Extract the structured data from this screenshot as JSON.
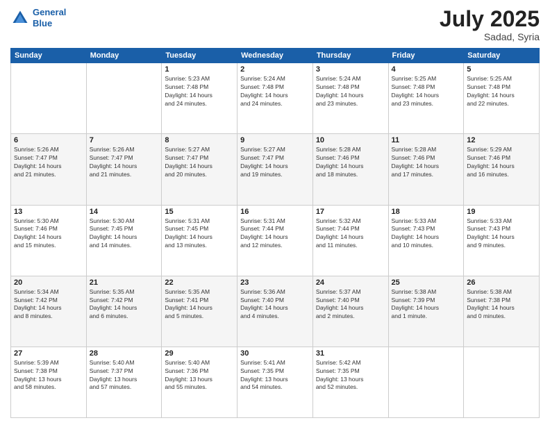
{
  "header": {
    "logo_line1": "General",
    "logo_line2": "Blue",
    "month": "July 2025",
    "location": "Sadad, Syria"
  },
  "weekdays": [
    "Sunday",
    "Monday",
    "Tuesday",
    "Wednesday",
    "Thursday",
    "Friday",
    "Saturday"
  ],
  "weeks": [
    [
      {
        "day": "",
        "info": ""
      },
      {
        "day": "",
        "info": ""
      },
      {
        "day": "1",
        "info": "Sunrise: 5:23 AM\nSunset: 7:48 PM\nDaylight: 14 hours\nand 24 minutes."
      },
      {
        "day": "2",
        "info": "Sunrise: 5:24 AM\nSunset: 7:48 PM\nDaylight: 14 hours\nand 24 minutes."
      },
      {
        "day": "3",
        "info": "Sunrise: 5:24 AM\nSunset: 7:48 PM\nDaylight: 14 hours\nand 23 minutes."
      },
      {
        "day": "4",
        "info": "Sunrise: 5:25 AM\nSunset: 7:48 PM\nDaylight: 14 hours\nand 23 minutes."
      },
      {
        "day": "5",
        "info": "Sunrise: 5:25 AM\nSunset: 7:48 PM\nDaylight: 14 hours\nand 22 minutes."
      }
    ],
    [
      {
        "day": "6",
        "info": "Sunrise: 5:26 AM\nSunset: 7:47 PM\nDaylight: 14 hours\nand 21 minutes."
      },
      {
        "day": "7",
        "info": "Sunrise: 5:26 AM\nSunset: 7:47 PM\nDaylight: 14 hours\nand 21 minutes."
      },
      {
        "day": "8",
        "info": "Sunrise: 5:27 AM\nSunset: 7:47 PM\nDaylight: 14 hours\nand 20 minutes."
      },
      {
        "day": "9",
        "info": "Sunrise: 5:27 AM\nSunset: 7:47 PM\nDaylight: 14 hours\nand 19 minutes."
      },
      {
        "day": "10",
        "info": "Sunrise: 5:28 AM\nSunset: 7:46 PM\nDaylight: 14 hours\nand 18 minutes."
      },
      {
        "day": "11",
        "info": "Sunrise: 5:28 AM\nSunset: 7:46 PM\nDaylight: 14 hours\nand 17 minutes."
      },
      {
        "day": "12",
        "info": "Sunrise: 5:29 AM\nSunset: 7:46 PM\nDaylight: 14 hours\nand 16 minutes."
      }
    ],
    [
      {
        "day": "13",
        "info": "Sunrise: 5:30 AM\nSunset: 7:46 PM\nDaylight: 14 hours\nand 15 minutes."
      },
      {
        "day": "14",
        "info": "Sunrise: 5:30 AM\nSunset: 7:45 PM\nDaylight: 14 hours\nand 14 minutes."
      },
      {
        "day": "15",
        "info": "Sunrise: 5:31 AM\nSunset: 7:45 PM\nDaylight: 14 hours\nand 13 minutes."
      },
      {
        "day": "16",
        "info": "Sunrise: 5:31 AM\nSunset: 7:44 PM\nDaylight: 14 hours\nand 12 minutes."
      },
      {
        "day": "17",
        "info": "Sunrise: 5:32 AM\nSunset: 7:44 PM\nDaylight: 14 hours\nand 11 minutes."
      },
      {
        "day": "18",
        "info": "Sunrise: 5:33 AM\nSunset: 7:43 PM\nDaylight: 14 hours\nand 10 minutes."
      },
      {
        "day": "19",
        "info": "Sunrise: 5:33 AM\nSunset: 7:43 PM\nDaylight: 14 hours\nand 9 minutes."
      }
    ],
    [
      {
        "day": "20",
        "info": "Sunrise: 5:34 AM\nSunset: 7:42 PM\nDaylight: 14 hours\nand 8 minutes."
      },
      {
        "day": "21",
        "info": "Sunrise: 5:35 AM\nSunset: 7:42 PM\nDaylight: 14 hours\nand 6 minutes."
      },
      {
        "day": "22",
        "info": "Sunrise: 5:35 AM\nSunset: 7:41 PM\nDaylight: 14 hours\nand 5 minutes."
      },
      {
        "day": "23",
        "info": "Sunrise: 5:36 AM\nSunset: 7:40 PM\nDaylight: 14 hours\nand 4 minutes."
      },
      {
        "day": "24",
        "info": "Sunrise: 5:37 AM\nSunset: 7:40 PM\nDaylight: 14 hours\nand 2 minutes."
      },
      {
        "day": "25",
        "info": "Sunrise: 5:38 AM\nSunset: 7:39 PM\nDaylight: 14 hours\nand 1 minute."
      },
      {
        "day": "26",
        "info": "Sunrise: 5:38 AM\nSunset: 7:38 PM\nDaylight: 14 hours\nand 0 minutes."
      }
    ],
    [
      {
        "day": "27",
        "info": "Sunrise: 5:39 AM\nSunset: 7:38 PM\nDaylight: 13 hours\nand 58 minutes."
      },
      {
        "day": "28",
        "info": "Sunrise: 5:40 AM\nSunset: 7:37 PM\nDaylight: 13 hours\nand 57 minutes."
      },
      {
        "day": "29",
        "info": "Sunrise: 5:40 AM\nSunset: 7:36 PM\nDaylight: 13 hours\nand 55 minutes."
      },
      {
        "day": "30",
        "info": "Sunrise: 5:41 AM\nSunset: 7:35 PM\nDaylight: 13 hours\nand 54 minutes."
      },
      {
        "day": "31",
        "info": "Sunrise: 5:42 AM\nSunset: 7:35 PM\nDaylight: 13 hours\nand 52 minutes."
      },
      {
        "day": "",
        "info": ""
      },
      {
        "day": "",
        "info": ""
      }
    ]
  ]
}
